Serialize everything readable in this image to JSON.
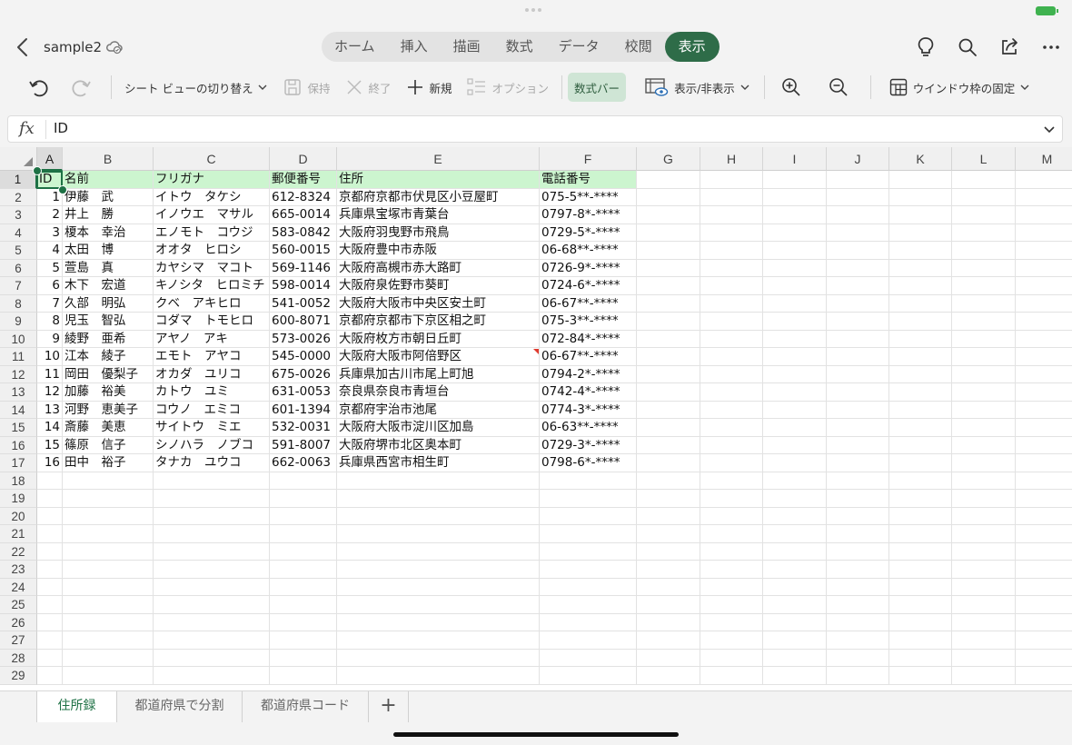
{
  "window": {
    "doc_title": "sample2"
  },
  "tabs": [
    {
      "label": "ホーム",
      "active": false
    },
    {
      "label": "挿入",
      "active": false
    },
    {
      "label": "描画",
      "active": false
    },
    {
      "label": "数式",
      "active": false
    },
    {
      "label": "データ",
      "active": false
    },
    {
      "label": "校閲",
      "active": false
    },
    {
      "label": "表示",
      "active": true
    }
  ],
  "toolbar": {
    "sheet_view_switch": "シート ビューの切り替え",
    "keep": "保持",
    "exit": "終了",
    "new": "新規",
    "options": "オプション",
    "formula_bar": "数式バー",
    "show_hide": "表示/非表示",
    "freeze_panes": "ウインドウ枠の固定"
  },
  "formula_bar": {
    "label": "fx",
    "value": "ID"
  },
  "columns": [
    "A",
    "B",
    "C",
    "D",
    "E",
    "F",
    "G",
    "H",
    "I",
    "J",
    "K",
    "L",
    "M"
  ],
  "header_row": [
    "ID",
    "名前",
    "フリガナ",
    "郵便番号",
    "住所",
    "電話番号"
  ],
  "rows": [
    [
      "1",
      "伊藤　武",
      "イトウ　タケシ",
      "612-8324",
      "京都府京都市伏見区小豆屋町",
      "075-5**-****"
    ],
    [
      "2",
      "井上　勝",
      "イノウエ　マサル",
      "665-0014",
      "兵庫県宝塚市青葉台",
      "0797-8*-****"
    ],
    [
      "3",
      "榎本　幸治",
      "エノモト　コウジ",
      "583-0842",
      "大阪府羽曳野市飛鳥",
      "0729-5*-****"
    ],
    [
      "4",
      "太田　博",
      "オオタ　ヒロシ",
      "560-0015",
      "大阪府豊中市赤阪",
      "06-68**-****"
    ],
    [
      "5",
      "萱島　真",
      "カヤシマ　マコト",
      "569-1146",
      "大阪府高槻市赤大路町",
      "0726-9*-****"
    ],
    [
      "6",
      "木下　宏道",
      "キノシタ　ヒロミチ",
      "598-0014",
      "大阪府泉佐野市葵町",
      "0724-6*-****"
    ],
    [
      "7",
      "久部　明弘",
      "クベ　アキヒロ",
      "541-0052",
      "大阪府大阪市中央区安土町",
      "06-67**-****"
    ],
    [
      "8",
      "児玉　智弘",
      "コダマ　トモヒロ",
      "600-8071",
      "京都府京都市下京区相之町",
      "075-3**-****"
    ],
    [
      "9",
      "綾野　亜希",
      "アヤノ　アキ",
      "573-0026",
      "大阪府枚方市朝日丘町",
      "072-84*-****"
    ],
    [
      "10",
      "江本　綾子",
      "エモト　アヤコ",
      "545-0000",
      "大阪府大阪市阿倍野区",
      "06-67**-****"
    ],
    [
      "11",
      "岡田　優梨子",
      "オカダ　ユリコ",
      "675-0026",
      "兵庫県加古川市尾上町旭",
      "0794-2*-****"
    ],
    [
      "12",
      "加藤　裕美",
      "カトウ　ユミ",
      "631-0053",
      "奈良県奈良市青垣台",
      "0742-4*-****"
    ],
    [
      "13",
      "河野　恵美子",
      "コウノ　エミコ",
      "601-1394",
      "京都府宇治市池尾",
      "0774-3*-****"
    ],
    [
      "14",
      "斎藤　美恵",
      "サイトウ　ミエ",
      "532-0031",
      "大阪府大阪市淀川区加島",
      "06-63**-****"
    ],
    [
      "15",
      "篠原　信子",
      "シノハラ　ノブコ",
      "591-8007",
      "大阪府堺市北区奥本町",
      "0729-3*-****"
    ],
    [
      "16",
      "田中　裕子",
      "タナカ　ユウコ",
      "662-0063",
      "兵庫県西宮市相生町",
      "0798-6*-****"
    ]
  ],
  "row_numbers": [
    "1",
    "2",
    "3",
    "4",
    "5",
    "6",
    "7",
    "8",
    "9",
    "10",
    "11",
    "12",
    "13",
    "14",
    "15",
    "16",
    "17",
    "18",
    "19",
    "20",
    "21",
    "22",
    "23",
    "24",
    "25",
    "26",
    "27",
    "28",
    "29"
  ],
  "sheets": [
    {
      "label": "住所録",
      "active": true
    },
    {
      "label": "都道府県で分割",
      "active": false
    },
    {
      "label": "都道府県コード",
      "active": false
    }
  ],
  "add_sheet": "+",
  "colors": {
    "accent": "#1e7145",
    "tab_active": "#2e6c48",
    "header_fill": "#ccf5cf",
    "comment": "#e03a2e"
  }
}
